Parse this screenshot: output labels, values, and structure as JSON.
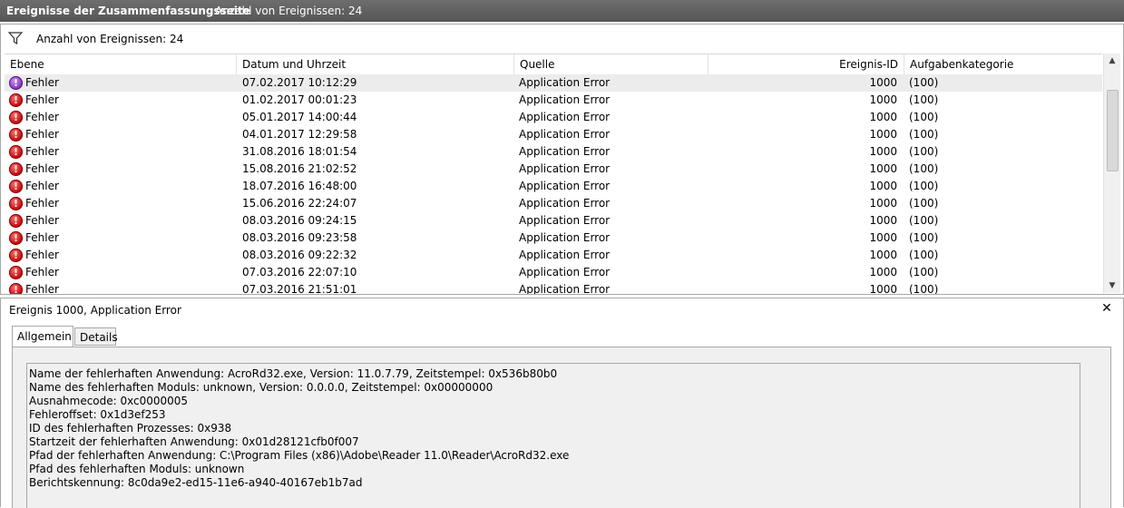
{
  "title": {
    "main": "Ereignisse der Zusammenfassungsseite",
    "count": "Anzahl von Ereignissen: 24"
  },
  "filter": {
    "icon": "filter-icon",
    "text": "Anzahl von Ereignissen: 24"
  },
  "columns": {
    "ebene": "Ebene",
    "datum": "Datum und Uhrzeit",
    "quelle": "Quelle",
    "id": "Ereignis-ID",
    "kategorie": "Aufgabenkategorie"
  },
  "events": [
    {
      "level": "Fehler",
      "date": "07.02.2017 10:12:29",
      "source": "Application Error",
      "id": "1000",
      "category": "(100)",
      "selected": true
    },
    {
      "level": "Fehler",
      "date": "01.02.2017 00:01:23",
      "source": "Application Error",
      "id": "1000",
      "category": "(100)"
    },
    {
      "level": "Fehler",
      "date": "05.01.2017 14:00:44",
      "source": "Application Error",
      "id": "1000",
      "category": "(100)"
    },
    {
      "level": "Fehler",
      "date": "04.01.2017 12:29:58",
      "source": "Application Error",
      "id": "1000",
      "category": "(100)"
    },
    {
      "level": "Fehler",
      "date": "31.08.2016 18:01:54",
      "source": "Application Error",
      "id": "1000",
      "category": "(100)"
    },
    {
      "level": "Fehler",
      "date": "15.08.2016 21:02:52",
      "source": "Application Error",
      "id": "1000",
      "category": "(100)"
    },
    {
      "level": "Fehler",
      "date": "18.07.2016 16:48:00",
      "source": "Application Error",
      "id": "1000",
      "category": "(100)"
    },
    {
      "level": "Fehler",
      "date": "15.06.2016 22:24:07",
      "source": "Application Error",
      "id": "1000",
      "category": "(100)"
    },
    {
      "level": "Fehler",
      "date": "08.03.2016 09:24:15",
      "source": "Application Error",
      "id": "1000",
      "category": "(100)"
    },
    {
      "level": "Fehler",
      "date": "08.03.2016 09:23:58",
      "source": "Application Error",
      "id": "1000",
      "category": "(100)"
    },
    {
      "level": "Fehler",
      "date": "08.03.2016 09:22:32",
      "source": "Application Error",
      "id": "1000",
      "category": "(100)"
    },
    {
      "level": "Fehler",
      "date": "07.03.2016 22:07:10",
      "source": "Application Error",
      "id": "1000",
      "category": "(100)"
    },
    {
      "level": "Fehler",
      "date": "07.03.2016 21:51:01",
      "source": "Application Error",
      "id": "1000",
      "category": "(100)"
    }
  ],
  "detail": {
    "title": "Ereignis 1000, Application Error",
    "tabs": [
      "Allgemein",
      "Details"
    ],
    "lines": [
      "Name der fehlerhaften Anwendung: AcroRd32.exe, Version: 11.0.7.79, Zeitstempel: 0x536b80b0",
      "Name des fehlerhaften Moduls: unknown, Version: 0.0.0.0, Zeitstempel: 0x00000000",
      "Ausnahmecode: 0xc0000005",
      "Fehleroffset: 0x1d3ef253",
      "ID des fehlerhaften Prozesses: 0x938",
      "Startzeit der fehlerhaften Anwendung: 0x01d28121cfb0f007",
      "Pfad der fehlerhaften Anwendung: C:\\Program Files (x86)\\Adobe\\Reader 11.0\\Reader\\AcroRd32.exe",
      "Pfad des fehlerhaften Moduls: unknown",
      "Berichtskennung: 8c0da9e2-ed15-11e6-a940-40167eb1b7ad"
    ]
  },
  "colors": {
    "error": "#c40000",
    "selected_row": "#ececec"
  }
}
